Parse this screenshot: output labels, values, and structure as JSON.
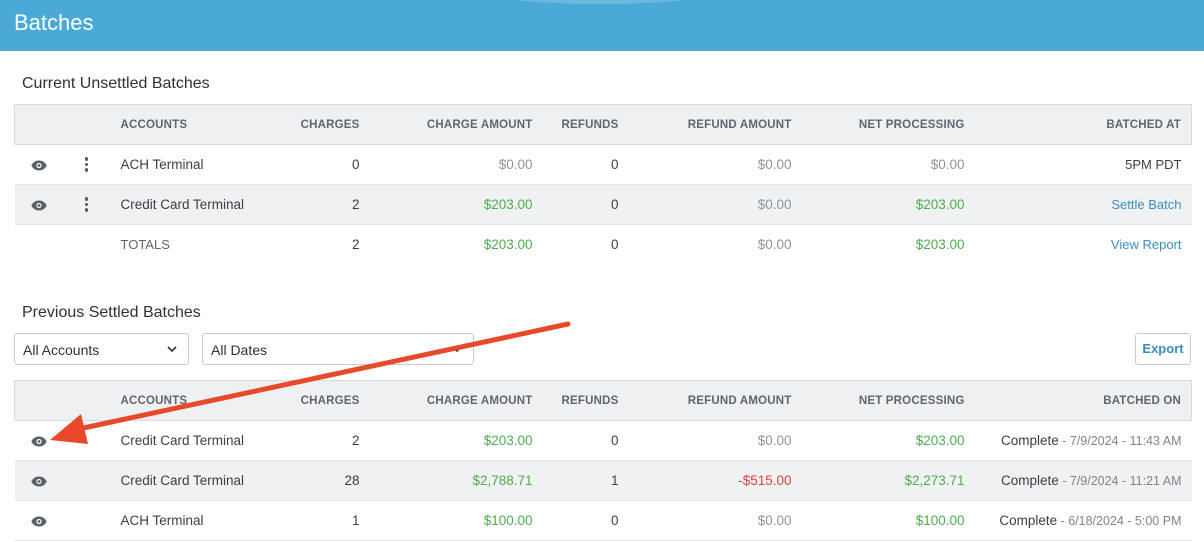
{
  "header": {
    "title": "Batches"
  },
  "current": {
    "title": "Current Unsettled Batches",
    "columns": [
      "ACCOUNTS",
      "CHARGES",
      "CHARGE AMOUNT",
      "REFUNDS",
      "REFUND AMOUNT",
      "NET PROCESSING",
      "BATCHED AT"
    ],
    "rows": [
      {
        "account": "ACH Terminal",
        "charges": "0",
        "charge_amount": "$0.00",
        "refunds": "0",
        "refund_amount": "$0.00",
        "net": "$0.00",
        "batched": "5PM PDT"
      },
      {
        "account": "Credit Card Terminal",
        "charges": "2",
        "charge_amount": "$203.00",
        "refunds": "0",
        "refund_amount": "$0.00",
        "net": "$203.00",
        "batched": "Settle Batch"
      }
    ],
    "totals": {
      "label": "TOTALS",
      "charges": "2",
      "charge_amount": "$203.00",
      "refunds": "0",
      "refund_amount": "$0.00",
      "net": "$203.00",
      "action": "View Report"
    }
  },
  "previous": {
    "title": "Previous Settled Batches",
    "filters": {
      "accounts": "All Accounts",
      "dates": "All Dates"
    },
    "export_label": "Export",
    "columns": [
      "ACCOUNTS",
      "CHARGES",
      "CHARGE AMOUNT",
      "REFUNDS",
      "REFUND AMOUNT",
      "NET PROCESSING",
      "BATCHED ON"
    ],
    "rows": [
      {
        "account": "Credit Card Terminal",
        "charges": "2",
        "charge_amount": "$203.00",
        "refunds": "0",
        "refund_amount": "$0.00",
        "net": "$203.00",
        "status": "Complete",
        "date": " - 7/9/2024 - 11:43 AM"
      },
      {
        "account": "Credit Card Terminal",
        "charges": "28",
        "charge_amount": "$2,788.71",
        "refunds": "1",
        "refund_amount": "-$515.00",
        "net": "$2,273.71",
        "status": "Complete",
        "date": " - 7/9/2024 - 11:21 AM"
      },
      {
        "account": "ACH Terminal",
        "charges": "1",
        "charge_amount": "$100.00",
        "refunds": "0",
        "refund_amount": "$0.00",
        "net": "$100.00",
        "status": "Complete",
        "date": " - 6/18/2024 - 5:00 PM"
      }
    ]
  },
  "colors": {
    "header": "#4aa9d6",
    "positive": "#4cae4c",
    "negative": "#e04141",
    "link": "#3a8fc0",
    "annotation_arrow": "#e8492a"
  },
  "icons": {
    "view": "eye-icon",
    "actions": "kebab-menu-icon",
    "dropdown": "chevron-down-icon"
  }
}
